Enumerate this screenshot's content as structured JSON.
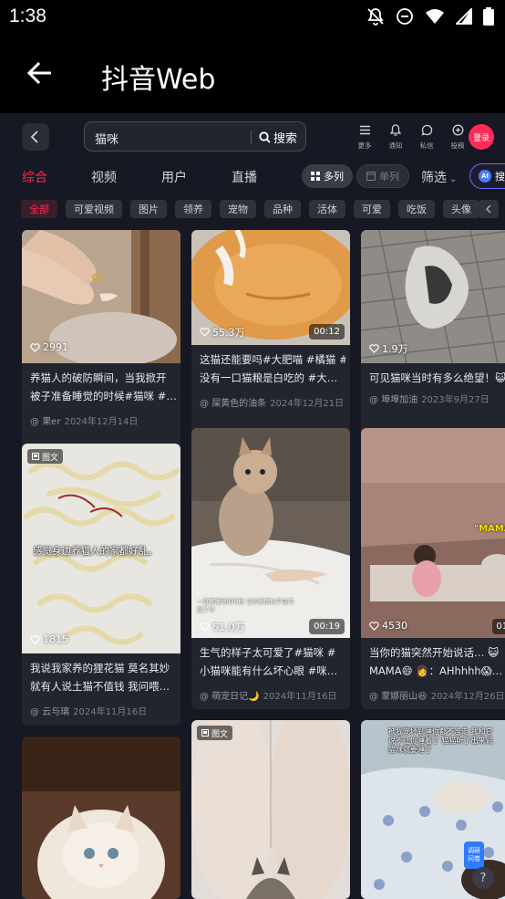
{
  "status": {
    "time": "1:38"
  },
  "app": {
    "title": "抖音Web"
  },
  "header": {
    "search_text": "猫咪",
    "search_button": "搜索",
    "icons": [
      {
        "name": "more",
        "label": "更多"
      },
      {
        "name": "notify",
        "label": "通知"
      },
      {
        "name": "message",
        "label": "私信"
      },
      {
        "name": "post",
        "label": "投稿"
      }
    ],
    "login": "登录"
  },
  "tabs": {
    "items": [
      "综合",
      "视频",
      "用户",
      "直播"
    ],
    "multi_col": "多列",
    "single_col": "单列",
    "filter": "筛选",
    "ai_search": "搜",
    "ai_badge": "AI"
  },
  "chips": [
    "全部",
    "可爱视频",
    "图片",
    "领养",
    "宠物",
    "品种",
    "活体",
    "可爱",
    "吃饭",
    "头像"
  ],
  "colors": {
    "accent": "#fe2c55",
    "bg": "#161823",
    "card": "#22242e"
  },
  "cards": [
    {
      "likes": "2991",
      "duration": "",
      "desc_line1": "养猫人的破防瞬间，当我掀开",
      "desc_line2": "被子准备睡觉的时候#猫咪 #…",
      "author": "果er",
      "date": "2024年12月14日"
    },
    {
      "likes": "55.3万",
      "duration": "00:12",
      "desc_line1": "这猫还能要吗#大肥喵 #橘猫 #",
      "desc_line2": "没有一口猫粮是白吃的 #大…",
      "author": "屎黄色的油条",
      "date": "2024年12月21日"
    },
    {
      "likes": "1.9万",
      "duration": "",
      "desc_line1": "可见猫咪当时有多么绝望！😺",
      "desc_line2": "",
      "author": "埠埠加油",
      "date": "2023年9月27日"
    },
    {
      "likes": "1815",
      "duration": "",
      "badge": "图文",
      "overlay_text": "感觉身边养猫人的家都好乱。",
      "desc_line1": "我说我家养的狸花猫 莫名其妙",
      "desc_line2": "就有人说土猫不值钱 我问喂…",
      "author": "云与璃",
      "date": "2024年11月16日"
    },
    {
      "likes": "51.0万",
      "duration": "00:19",
      "overlay_text": "一直要睡觉的时候 它的表情似乎在问我了😮",
      "desc_line1": "生气的样子太可爱了#猫咪 #",
      "desc_line2": "小猫咪能有什么坏心眼 #咪…",
      "author": "萌宠日记🌙",
      "date": "2024年11月16日"
    },
    {
      "likes": "4530",
      "duration": "01:0",
      "overlay_text": "\"MAMA",
      "desc_line1": "当你的猫突然开始说话… 😺",
      "desc_line2": "MAMA😄 👩：AHhhhh😱…",
      "author": "蒙娜丽山😆",
      "date": "2024年12月26日"
    },
    {
      "likes": "",
      "duration": ""
    },
    {
      "likes": "",
      "duration": "",
      "badge": "图文"
    },
    {
      "likes": "",
      "duration": "",
      "overlay_text": "被我宠坏到睡你都不准走 我和它说不让你睡着了 猫猫听了出来说猫咪就要睡了"
    }
  ],
  "feedback": "调研\n问卷",
  "help": "?"
}
